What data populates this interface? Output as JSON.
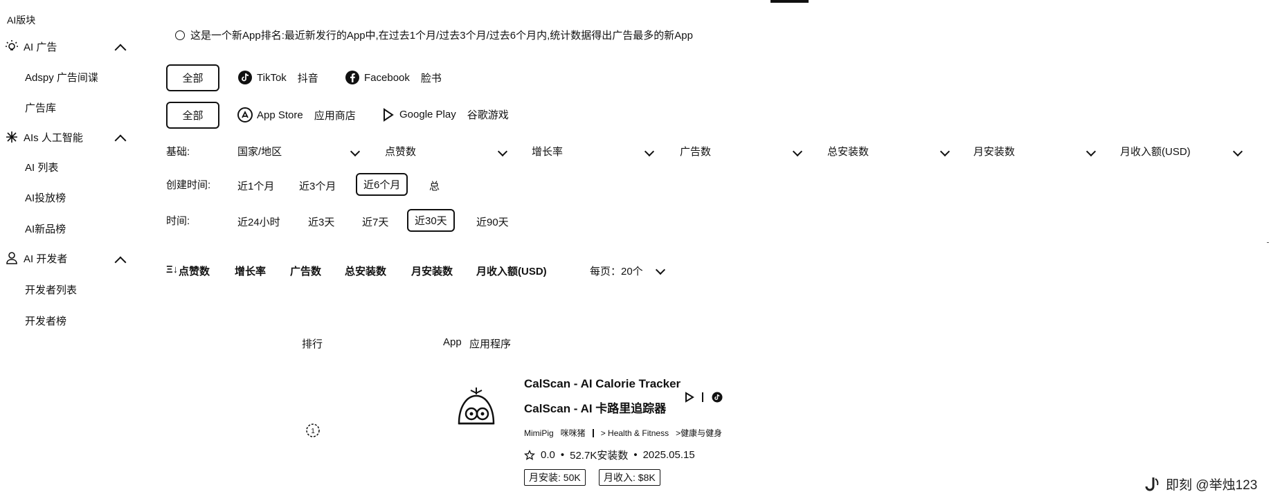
{
  "sidebar": {
    "title": "AI版块",
    "sections": [
      {
        "label": "AI 广告",
        "icon": "lightbulb-icon",
        "items": [
          "Adspy  广告间谍",
          "广告库"
        ]
      },
      {
        "label": "AIs  人工智能",
        "icon": "ai-sparkle-icon",
        "items": [
          "AI 列表",
          "AI投放榜",
          "AI新品榜"
        ]
      },
      {
        "label": "AI 开发者",
        "icon": "user-icon",
        "items": [
          "开发者列表",
          "开发者榜"
        ]
      }
    ]
  },
  "notice": "这是一个新App排名:最近新发行的App中,在过去1个月/过去3个月/过去6个月内,统计数据得出广告最多的新App",
  "platform_row": {
    "all": "全部",
    "tiktok_en": "TikTok",
    "tiktok_cn": "抖音",
    "facebook_en": "Facebook",
    "facebook_cn": "脸书"
  },
  "store_row": {
    "all": "全部",
    "appstore_en": "App Store",
    "appstore_cn": "应用商店",
    "gplay_en": "Google Play",
    "gplay_cn": "谷歌游戏"
  },
  "basic_filters": {
    "label": "基础:",
    "options": [
      "国家/地区",
      "点赞数",
      "增长率",
      "广告数",
      "总安装数",
      "月安装数",
      "月收入额(USD)"
    ]
  },
  "created_time": {
    "label": "创建时间:",
    "options": [
      "近1个月",
      "近3个月",
      "近6个月",
      "总"
    ],
    "selected": "近6个月"
  },
  "time": {
    "label": "时间:",
    "options": [
      "近24小时",
      "近3天",
      "近7天",
      "近30天",
      "近90天"
    ],
    "selected": "近30天"
  },
  "sort_bar": {
    "items": [
      "点赞数",
      "增长率",
      "广告数",
      "总安装数",
      "月安装数",
      "月收入额(USD)"
    ],
    "sort_icon_text": "Ξ↓",
    "page_size": "每页：20个"
  },
  "table_headers": {
    "rank": "排行",
    "app_en": "App",
    "app_cn": "应用程序"
  },
  "app_row": {
    "name_en": "CalScan - AI Calorie Tracker",
    "name_cn": "CalScan - AI 卡路里追踪器",
    "developer_en": "MimiPig",
    "developer_cn": "咪咪猪",
    "category_en": "> Health & Fitness",
    "category_cn": ">健康与健身",
    "rating": "0.0",
    "installs": "52.7K安装数",
    "date": "2025.05.15",
    "monthly_installs": "月安装: 50K",
    "monthly_revenue": "月收入: $8K"
  },
  "watermark": "即刻 @举烛123"
}
